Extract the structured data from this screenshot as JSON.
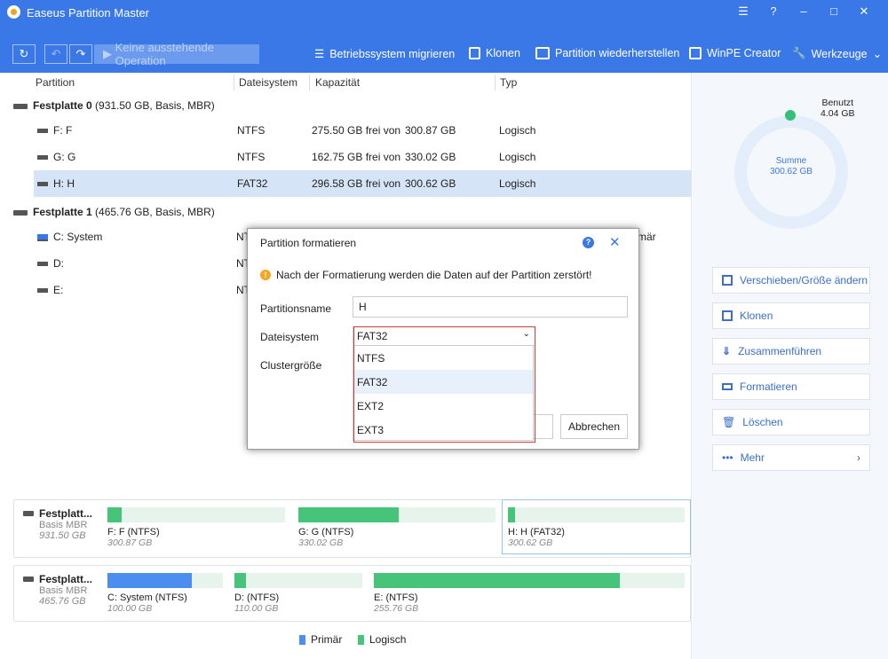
{
  "window": {
    "title": "Easeus Partition Master",
    "controls": [
      "☰",
      "?",
      "–",
      "□",
      "✕"
    ]
  },
  "toolbar": {
    "pending": "Keine ausstehende Operation",
    "migrate": "Betriebssystem migrieren",
    "clone": "Klonen",
    "recover": "Partition wiederherstellen",
    "winpe": "WinPE Creator",
    "tools": "Werkzeuge"
  },
  "table": {
    "headers": [
      "Partition",
      "Dateisystem",
      "Kapazität",
      "Typ"
    ],
    "disk0": {
      "name": "Festplatte 0",
      "info": "(931.50 GB, Basis, MBR)"
    },
    "disk1": {
      "name": "Festplatte 1",
      "info": "(465.76 GB, Basis, MBR)"
    },
    "rows0": [
      {
        "name": "F: F",
        "fs": "NTFS",
        "free": "275.50 GB frei von",
        "total": "300.87 GB",
        "type": "Logisch"
      },
      {
        "name": "G: G",
        "fs": "NTFS",
        "free": "162.75 GB frei von",
        "total": "330.02 GB",
        "type": "Logisch"
      },
      {
        "name": "H: H",
        "fs": "FAT32",
        "free": "296.58 GB frei von",
        "total": "300.62 GB",
        "type": "Logisch"
      }
    ],
    "rows1": [
      {
        "name": "C: System",
        "fs": "NT",
        "type_tail": "mär"
      },
      {
        "name": "D:",
        "fs": "NT"
      },
      {
        "name": "E:",
        "fs": "NT"
      }
    ]
  },
  "diskmap": {
    "d0": {
      "name": "Festplatt...",
      "type": "Basis MBR",
      "size": "931.50 GB",
      "parts": [
        {
          "label": "F: F (NTFS)",
          "size": "300.87 GB",
          "used": 0.08
        },
        {
          "label": "G: G (NTFS)",
          "size": "330.02 GB",
          "used": 0.51
        },
        {
          "label": "H: H (FAT32)",
          "size": "300.62 GB",
          "used": 0.04
        }
      ]
    },
    "d1": {
      "name": "Festplatt...",
      "type": "Basis MBR",
      "size": "465.76 GB",
      "parts": [
        {
          "label": "C: System (NTFS)",
          "size": "100.00 GB",
          "used": 0.73
        },
        {
          "label": "D:  (NTFS)",
          "size": "110.00 GB",
          "used": 0.09
        },
        {
          "label": "E:  (NTFS)",
          "size": "255.76 GB",
          "used": 0.79
        }
      ]
    }
  },
  "legend": {
    "primary": "Primär",
    "logical": "Logisch"
  },
  "colors": {
    "primary": "#4c8df0",
    "logical": "#45c47a",
    "accent": "#3b78e7"
  },
  "side": {
    "used_label": "Benutzt",
    "used_value": "4.04 GB",
    "sum_label": "Summe",
    "sum_value": "300.62 GB",
    "actions": [
      "Verschieben/Größe ändern",
      "Klonen",
      "Zusammenführen",
      "Formatieren",
      "Löschen",
      "Mehr"
    ]
  },
  "dialog": {
    "title": "Partition formatieren",
    "warning": "Nach der Formatierung werden die Daten auf der Partition zerstört!",
    "name_label": "Partitionsname",
    "name_value": "H",
    "fs_label": "Dateisystem",
    "fs_value": "FAT32",
    "cluster_label": "Clustergröße",
    "options": [
      "NTFS",
      "FAT32",
      "EXT2",
      "EXT3"
    ],
    "cancel": "Abbrechen"
  }
}
